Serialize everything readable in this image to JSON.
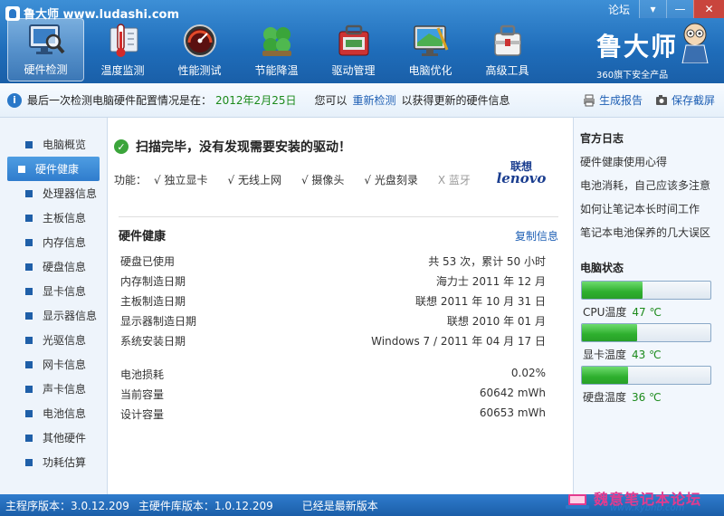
{
  "app": {
    "title": "鲁大师 www.ludashi.com",
    "forum_link": "论坛",
    "controls": {
      "menu": "▾",
      "minimize": "—",
      "close": "✕"
    }
  },
  "toolbar": {
    "items": [
      {
        "label": "硬件检测",
        "icon": "monitor-magnifier-icon",
        "active": true
      },
      {
        "label": "温度监测",
        "icon": "thermometer-icon"
      },
      {
        "label": "性能测试",
        "icon": "speedometer-icon"
      },
      {
        "label": "节能降温",
        "icon": "clover-leaf-icon"
      },
      {
        "label": "驱动管理",
        "icon": "toolbox-icon"
      },
      {
        "label": "电脑优化",
        "icon": "monitor-broom-icon"
      },
      {
        "label": "高级工具",
        "icon": "toolkit-icon"
      }
    ]
  },
  "brand": {
    "name": "鲁大师",
    "subtitle": "360旗下安全产品"
  },
  "infobar": {
    "prefix": "最后一次检测电脑硬件配置情况是在：",
    "date": "2012年2月25日",
    "middle": "您可以",
    "recheck_link": "重新检测",
    "suffix": "以获得更新的硬件信息",
    "report_button": "生成报告",
    "screenshot_button": "保存截屏"
  },
  "sidebar": {
    "items": [
      {
        "label": "电脑概览"
      },
      {
        "label": "硬件健康",
        "active": true
      },
      {
        "label": "处理器信息"
      },
      {
        "label": "主板信息"
      },
      {
        "label": "内存信息"
      },
      {
        "label": "硬盘信息"
      },
      {
        "label": "显卡信息"
      },
      {
        "label": "显示器信息"
      },
      {
        "label": "光驱信息"
      },
      {
        "label": "网卡信息"
      },
      {
        "label": "声卡信息"
      },
      {
        "label": "电池信息"
      },
      {
        "label": "其他硬件"
      },
      {
        "label": "功耗估算"
      }
    ]
  },
  "main": {
    "scan_result": "扫描完毕，没有发现需要安装的驱动！",
    "features_label": "功能：",
    "features": [
      {
        "label": "√ 独立显卡",
        "enabled": true
      },
      {
        "label": "√ 无线上网",
        "enabled": true
      },
      {
        "label": "√ 摄像头",
        "enabled": true
      },
      {
        "label": "√ 光盘刻录",
        "enabled": true
      },
      {
        "label": "X 蓝牙",
        "enabled": false
      }
    ],
    "vendor_logo": {
      "cn": "联想",
      "en": "lenovo"
    },
    "section_title": "硬件健康",
    "copy_link": "复制信息",
    "rows": [
      {
        "label": "硬盘已使用",
        "value": "共 53 次，累计 50 小时"
      },
      {
        "label": "内存制造日期",
        "value": "海力士 2011 年 12 月"
      },
      {
        "label": "主板制造日期",
        "value": "联想 2011 年 10 月 31 日"
      },
      {
        "label": "显示器制造日期",
        "value": "联想 2010 年 01 月"
      },
      {
        "label": "系统安装日期",
        "value": "Windows 7 / 2011 年 04 月 17 日"
      }
    ],
    "battery_rows": [
      {
        "label": "电池损耗",
        "value": "0.02%"
      },
      {
        "label": "当前容量",
        "value": "60642 mWh"
      },
      {
        "label": "设计容量",
        "value": "60653 mWh"
      }
    ]
  },
  "right_panel": {
    "log_title": "官方日志",
    "logs": [
      "硬件健康使用心得",
      "电池消耗，自己应该多注意",
      "如何让笔记本长时间工作",
      "笔记本电池保养的几大误区"
    ],
    "status_title": "电脑状态",
    "temps": [
      {
        "label": "CPU温度",
        "value": "47 ℃",
        "level": 0.47
      },
      {
        "label": "显卡温度",
        "value": "43 ℃",
        "level": 0.43
      },
      {
        "label": "硬盘温度",
        "value": "36 ℃",
        "level": 0.36
      }
    ]
  },
  "statusbar": {
    "main_version": "主程序版本：3.0.12.209",
    "db_version": "主硬件库版本：1.0.12.209",
    "update_status": "已经是最新版本"
  },
  "watermark": {
    "text": "魏意笔记本论坛",
    "url": "www.kybnb.com"
  },
  "colors": {
    "accent": "#2f7ccd",
    "good": "#1b8a1b",
    "link": "#1e5fb4"
  }
}
